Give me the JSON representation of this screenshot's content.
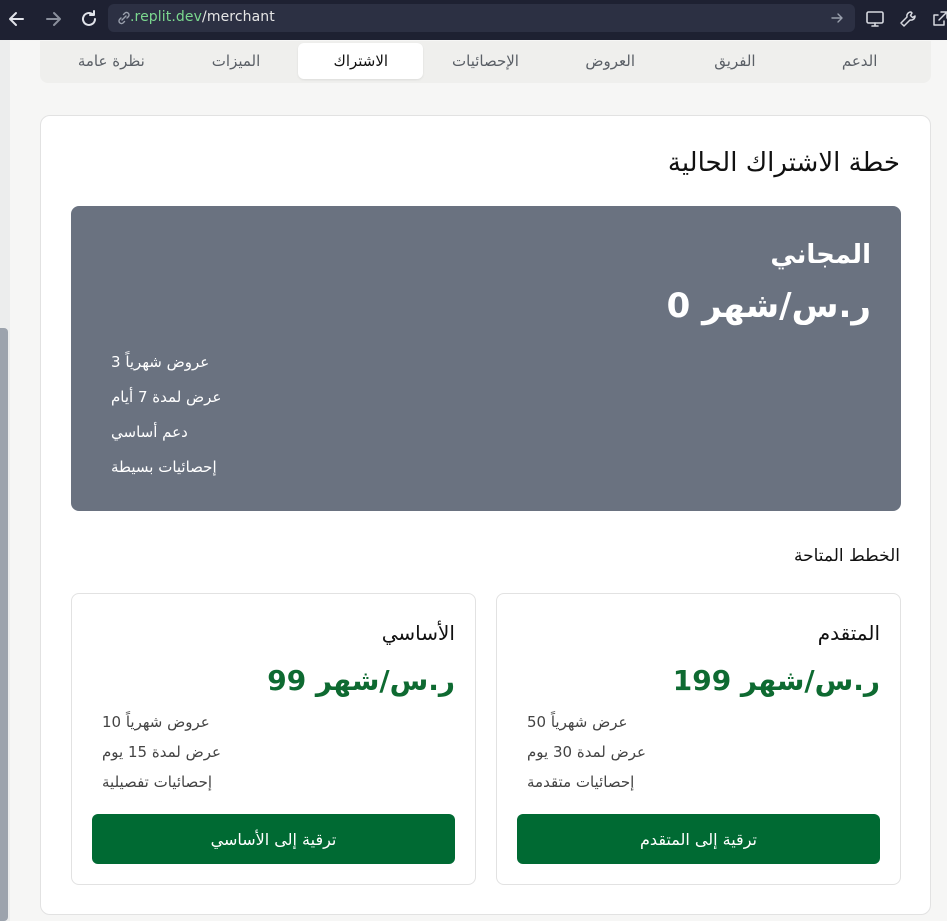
{
  "browser": {
    "url_domain": ".replit.dev",
    "url_path": "/merchant",
    "icons": [
      "back-icon",
      "forward-icon",
      "reload-icon",
      "link-icon",
      "go-icon",
      "monitor-icon",
      "wrench-icon",
      "external-link-icon"
    ]
  },
  "tabs": [
    {
      "label": "الدعم"
    },
    {
      "label": "الفريق"
    },
    {
      "label": "العروض"
    },
    {
      "label": "الإحصائيات"
    },
    {
      "label": "الاشتراك",
      "active": true
    },
    {
      "label": "الميزات"
    },
    {
      "label": "نظرة عامة"
    }
  ],
  "current": {
    "heading": "خطة الاشتراك الحالية",
    "plan_name": "المجاني",
    "price": "ر.س/شهر 0",
    "features": [
      "عروض شهرياً 3",
      "عرض لمدة 7 أيام",
      "دعم أساسي",
      "إحصائيات بسيطة"
    ]
  },
  "available": {
    "heading": "الخطط المتاحة",
    "plans": [
      {
        "name": "المتقدم",
        "price": "ر.س/شهر 199",
        "features": [
          "عرض شهرياً 50",
          "عرض لمدة 30 يوم",
          "إحصائيات متقدمة"
        ],
        "button": "ترقية إلى المتقدم"
      },
      {
        "name": "الأساسي",
        "price": "ر.س/شهر 99",
        "features": [
          "عروض شهرياً 10",
          "عرض لمدة 15 يوم",
          "إحصائيات تفصيلية"
        ],
        "button": "ترقية إلى الأساسي"
      }
    ]
  },
  "colors": {
    "accent_green": "#006a33",
    "price_green": "#0e6a31",
    "current_plan_bg": "#6a7280",
    "browser_bar": "#1e2132"
  }
}
